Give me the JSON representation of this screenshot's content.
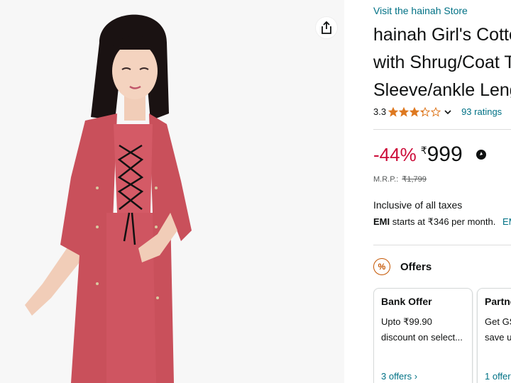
{
  "store_link": "Visit the hainah Store",
  "title_lines": [
    "hainah Girl's Cotton",
    "with Shrug/Coat To",
    "Sleeve/ankle Length"
  ],
  "rating": {
    "value_text": "3.3",
    "value": 3.3,
    "max": 5,
    "count_text": "93 ratings"
  },
  "price": {
    "discount": "-44%",
    "currency": "₹",
    "amount": "999",
    "mrp_label": "M.R.P.:",
    "mrp_value": "₹1,799"
  },
  "tax_note": "Inclusive of all taxes",
  "emi": {
    "label": "EMI",
    "text": "starts at ₹346 per month.",
    "more": "EMI"
  },
  "offers": {
    "heading": "Offers",
    "icon": "percent-badge-icon",
    "cards": [
      {
        "title": "Bank Offer",
        "line1": "Upto ₹99.90",
        "line2": "discount on select...",
        "link": "3 offers ›"
      },
      {
        "title": "Partne",
        "line1": "Get GS",
        "line2": "save u",
        "link": "1 offer"
      }
    ]
  },
  "colors": {
    "link": "#007185",
    "discount": "#cc0c39",
    "star": "#de7921",
    "dress": "#c9505b"
  }
}
